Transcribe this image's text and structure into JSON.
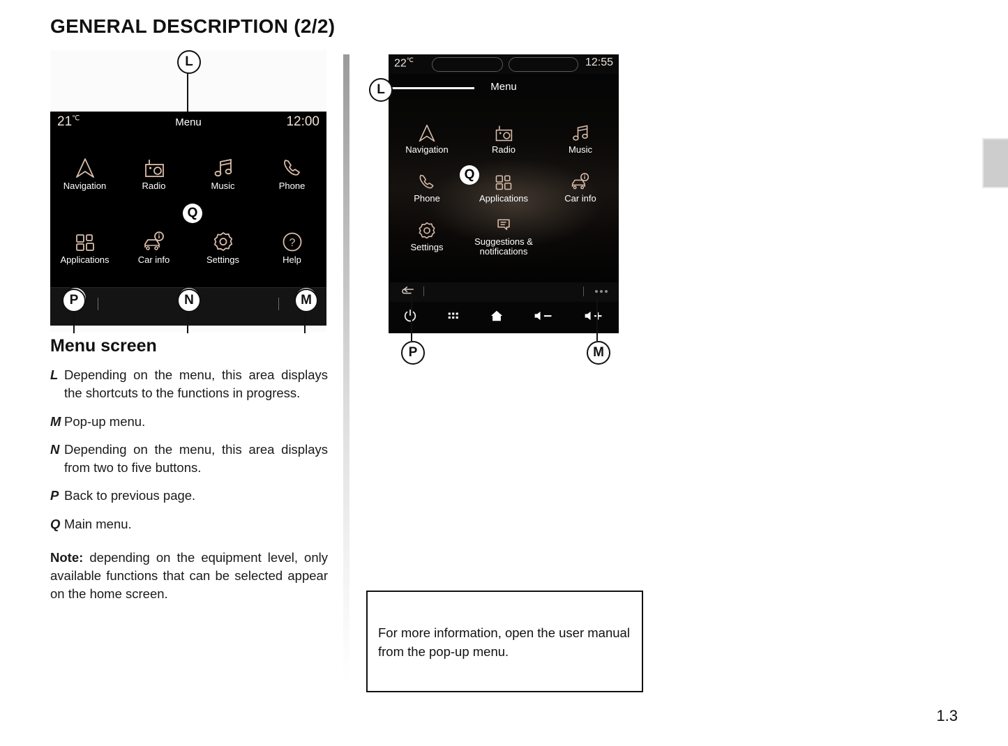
{
  "page": {
    "title": "GENERAL DESCRIPTION (2/2)",
    "number": "1.3"
  },
  "left_screen": {
    "caption_letters": {
      "l": "L",
      "p": "P",
      "n": "N",
      "m": "M",
      "q": "Q"
    },
    "status": {
      "temperature": "21",
      "unit": "℃",
      "title": "Menu",
      "clock": "12:00"
    },
    "tiles": [
      {
        "label": "Navigation",
        "icon": "navigation-arrow-icon"
      },
      {
        "label": "Radio",
        "icon": "radio-icon"
      },
      {
        "label": "Music",
        "icon": "music-note-icon"
      },
      {
        "label": "Phone",
        "icon": "phone-handset-icon"
      },
      {
        "label": "Applications",
        "icon": "apps-grid-icon"
      },
      {
        "label": "Car info",
        "icon": "car-info-icon"
      },
      {
        "label": "Settings",
        "icon": "gear-icon"
      },
      {
        "label": "Help",
        "icon": "question-mark-icon"
      }
    ],
    "bottom_bar": {
      "back": "back-arrow-icon",
      "more": "more-dots-icon"
    }
  },
  "right_screen": {
    "caption_letters": {
      "l": "L",
      "p": "P",
      "m": "M",
      "q": "Q"
    },
    "status": {
      "temperature": "22",
      "unit": "℃",
      "clock": "12:55"
    },
    "title": "Menu",
    "tiles": [
      {
        "label": "Navigation",
        "icon": "navigation-arrow-icon"
      },
      {
        "label": "Radio",
        "icon": "radio-icon"
      },
      {
        "label": "Music",
        "icon": "music-note-icon"
      },
      {
        "label": "Phone",
        "icon": "phone-handset-icon"
      },
      {
        "label": "Applications",
        "icon": "apps-grid-icon"
      },
      {
        "label": "Car info",
        "icon": "car-info-icon"
      },
      {
        "label": "Settings",
        "icon": "gear-icon"
      },
      {
        "label": "Suggestions & notifications",
        "icon": "notifications-icon"
      }
    ],
    "bottom_bar": {
      "back": "back-arrow-icon",
      "more": "more-dots-icon"
    },
    "hardware_bar": [
      {
        "icon": "power-icon"
      },
      {
        "icon": "apps-dots-icon"
      },
      {
        "icon": "home-icon"
      },
      {
        "icon": "volume-down-icon"
      },
      {
        "icon": "volume-up-icon"
      }
    ]
  },
  "description": {
    "heading": "Menu screen",
    "items": [
      {
        "key": "L",
        "text": "Depending on the menu, this area displays the shortcuts to the functions in progress."
      },
      {
        "key": "M",
        "text": "Pop-up menu."
      },
      {
        "key": "N",
        "text": "Depending on the menu, this area displays from two to five buttons."
      },
      {
        "key": "P",
        "text": "Back to previous page."
      },
      {
        "key": "Q",
        "text": "Main menu."
      }
    ],
    "note_label": "Note:",
    "note_text": " depending on the equipment level, only available functions that can be selected appear on the home screen."
  },
  "info_box": {
    "text": "For more information, open the user manual from the pop-up menu."
  },
  "colors": {
    "icon_tint": "#d9bdaa",
    "screen_bg": "#000000",
    "text": "#111111"
  }
}
